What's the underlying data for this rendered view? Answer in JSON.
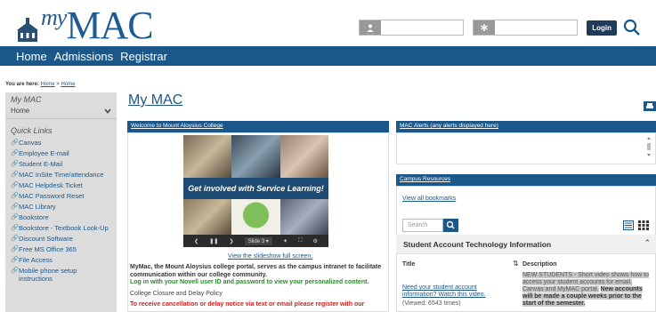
{
  "header": {
    "logo_my": "my",
    "logo_mac": "MAC",
    "login_label": "Login"
  },
  "nav": {
    "items": [
      "Home",
      "Admissions",
      "Registrar"
    ]
  },
  "breadcrumb": {
    "prefix": "You are here:",
    "home1": "Home",
    "sep": ">",
    "home2": "Home"
  },
  "sidebar": {
    "section_title": "My MAC",
    "selected": "Home",
    "quick_links_title": "Quick Links",
    "links": [
      "Canvas",
      "Employee E-mail",
      "Student E-Mail",
      "MAC InSite Time/attendance",
      "MAC Helpdesk Ticket",
      "MAC Password Reset",
      "MAC Library",
      "Bookstore",
      "Bookstore - Textbook Look-Up",
      "Discount Software",
      "Free MS Office 365",
      "File Access",
      "Mobile phone setup instructions"
    ]
  },
  "main": {
    "page_title": "My MAC",
    "welcome_header": "Welcome to Mount Aloysius College",
    "slideshow_banner": "Get involved with Service Learning!",
    "slide_label": "Slide 3",
    "fullscreen_link": "View the slideshow full screen.",
    "intro_bold": "MyMac, the Mount Aloysius college portal, serves as the campus intranet to facilitate communication within our college community.",
    "intro_green": "Log in with your Novell user ID and password to view your personalized content.",
    "closure_text": "College Closure and Delay Policy",
    "red_text": "To receive cancellation or delay notice via text or email please register with our"
  },
  "alerts": {
    "header": "MAC Alerts (any alerts displayed here)"
  },
  "resources": {
    "header": "Campus Resources",
    "view_all": "View all bookmarks",
    "search_placeholder": "Search",
    "section_title": "Student Account Technology Information",
    "col_title": "Title",
    "col_desc": "Description",
    "row_title": "Need your student account information? Watch this video.",
    "row_views": "(Viewed: 6543 times)",
    "row_desc_1": "NEW STUDENTS - Short video shows how to access your student accounts for email, Canvas and MyMAC portal.",
    "row_desc_2": "New accounts will be made a couple weeks prior to the start of the semester."
  },
  "colors": {
    "brand_blue": "#1c5789",
    "green": "#2a8a2a",
    "red": "#cc2222"
  }
}
